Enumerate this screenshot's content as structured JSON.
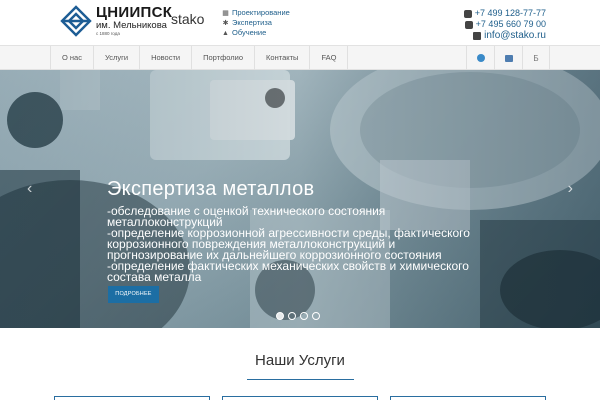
{
  "header": {
    "logo": {
      "title": "ЦНИИПСК",
      "subtitle": "им. Мельникова",
      "year": "с 1880 года",
      "brand": "stako"
    },
    "links": [
      {
        "label": "Проектирование",
        "icon": "building-icon"
      },
      {
        "label": "Экспертиза",
        "icon": "gear-icon"
      },
      {
        "label": "Обучение",
        "icon": "graduation-cap-icon"
      }
    ],
    "contacts": {
      "phone1": "+7 499 128-77-77",
      "phone2": "+7 495 660 79 00",
      "email": "info@stako.ru"
    }
  },
  "nav": {
    "items": [
      "О нас",
      "Услуги",
      "Новости",
      "Портфолио",
      "Контакты",
      "FAQ"
    ],
    "social": [
      "telegram-icon",
      "vk-icon",
      "behance-icon"
    ],
    "social_b_text": "Б"
  },
  "hero": {
    "title": "Экспертиза металлов",
    "lines": [
      "-обследование с оценкой технического состояния",
      "металлоконструкций",
      "-определение коррозионной агрессивности среды, фактического",
      "коррозионного повреждения металлоконструкций и",
      "прогнозирование их дальнейшего коррозионного состояния",
      "-определение фактических механических свойств и химического",
      "состава металла"
    ],
    "button": "ПОДРОБНЕЕ",
    "prev": "‹",
    "next": "›",
    "slides_total": 4,
    "slide_active": 1
  },
  "services": {
    "title": "Наши Услуги"
  },
  "colors": {
    "accent": "#1c6ea4",
    "link": "#1f5f8b"
  }
}
